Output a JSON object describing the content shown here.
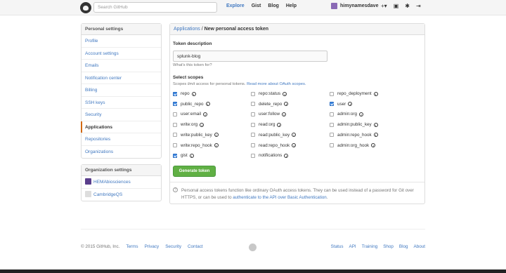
{
  "header": {
    "search_placeholder": "Search GitHub",
    "nav": [
      "Explore",
      "Gist",
      "Blog",
      "Help"
    ],
    "username": "himynamesdave",
    "icons": [
      "plus-icon",
      "notifications-icon",
      "settings-icon",
      "sign-out-icon"
    ]
  },
  "sidebar": {
    "personal_title": "Personal settings",
    "items": [
      "Profile",
      "Account settings",
      "Emails",
      "Notification center",
      "Billing",
      "SSH keys",
      "Security",
      "Applications",
      "Repositories",
      "Organizations"
    ],
    "selected": "Applications",
    "org_title": "Organization settings",
    "orgs": [
      "HEMAbiosciences",
      "CambridgeQS"
    ]
  },
  "main": {
    "breadcrumb_parent": "Applications",
    "breadcrumb_sep": " / ",
    "breadcrumb_current": "New personal access token",
    "token_label": "Token description",
    "token_value": "splunk-blog",
    "token_hint": "What's this token for?",
    "scopes_title": "Select scopes",
    "scopes_note_prefix": "Scopes ",
    "scopes_note_em": "limit",
    "scopes_note_mid": " access for personal tokens. ",
    "scopes_note_link": "Read more about OAuth scopes.",
    "scopes": [
      {
        "name": "repo",
        "checked": true
      },
      {
        "name": "repo:status",
        "checked": false
      },
      {
        "name": "repo_deployment",
        "checked": false
      },
      {
        "name": "public_repo",
        "checked": true
      },
      {
        "name": "delete_repo",
        "checked": false
      },
      {
        "name": "user",
        "checked": true
      },
      {
        "name": "user:email",
        "checked": false
      },
      {
        "name": "user:follow",
        "checked": false
      },
      {
        "name": "admin:org",
        "checked": false
      },
      {
        "name": "write:org",
        "checked": false
      },
      {
        "name": "read:org",
        "checked": false
      },
      {
        "name": "admin:public_key",
        "checked": false
      },
      {
        "name": "write:public_key",
        "checked": false
      },
      {
        "name": "read:public_key",
        "checked": false
      },
      {
        "name": "admin:repo_hook",
        "checked": false
      },
      {
        "name": "write:repo_hook",
        "checked": false
      },
      {
        "name": "read:repo_hook",
        "checked": false
      },
      {
        "name": "admin:org_hook",
        "checked": false
      },
      {
        "name": "gist",
        "checked": true
      },
      {
        "name": "notifications",
        "checked": false
      }
    ],
    "generate_label": "Generate token",
    "info_text": "Personal access tokens function like ordinary OAuth access tokens. They can be used instead of a password for Git over HTTPS, or can be used to ",
    "info_link": "authenticate to the API over Basic Authentication",
    "info_end": "."
  },
  "footer": {
    "copyright": "© 2015 GitHub, Inc.",
    "left_links": [
      "Terms",
      "Privacy",
      "Security",
      "Contact"
    ],
    "right_links": [
      "Status",
      "API",
      "Training",
      "Shop",
      "Blog",
      "About"
    ]
  },
  "colors": {
    "link": "#4078c0",
    "selected_marker": "#d26911",
    "button": "#60b044",
    "checkbox": "#3b87e3"
  }
}
